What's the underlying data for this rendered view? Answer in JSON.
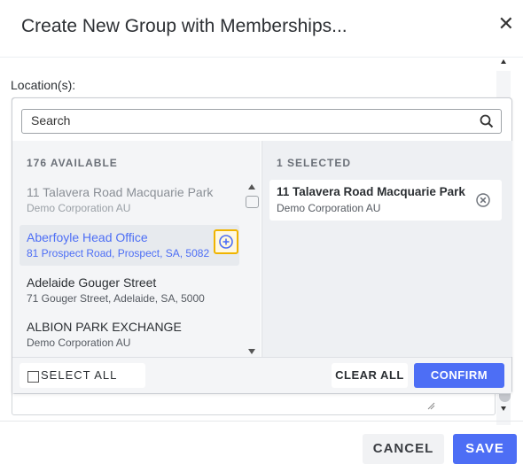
{
  "modal": {
    "title": "Create New Group with Memberships...",
    "close_glyph": "✕"
  },
  "form": {
    "location_label": "Location(s):"
  },
  "picker": {
    "search": {
      "placeholder": "Search",
      "value": ""
    },
    "available_heading": "176 AVAILABLE",
    "selected_heading": "1 SELECTED",
    "available_items": [
      {
        "name": "11 Talavera Road Macquarie Park",
        "sub": "Demo Corporation AU",
        "state": "disabled"
      },
      {
        "name": "Aberfoyle Head Office",
        "sub": "81 Prospect Road, Prospect, SA, 5082",
        "state": "hover"
      },
      {
        "name": "Adelaide Gouger Street",
        "sub": "71 Gouger Street, Adelaide, SA, 5000",
        "state": "normal"
      },
      {
        "name": "ALBION PARK EXCHANGE",
        "sub": "Demo Corporation AU",
        "state": "normal"
      }
    ],
    "selected_items": [
      {
        "name": "11 Talavera Road Macquarie Park",
        "sub": "Demo Corporation AU"
      }
    ],
    "select_all_label": "SELECT ALL",
    "clear_all_label": "CLEAR ALL",
    "confirm_label": "CONFIRM"
  },
  "footer": {
    "cancel_label": "CANCEL",
    "save_label": "SAVE"
  },
  "colors": {
    "accent": "#4d6ef5",
    "highlight_border": "#f0b400",
    "hover_text": "#4d6ef5",
    "disabled_text": "#8a8f96"
  },
  "icons": [
    "close-icon",
    "search-icon",
    "add-circle-icon",
    "remove-circle-icon",
    "checkbox-icon"
  ]
}
